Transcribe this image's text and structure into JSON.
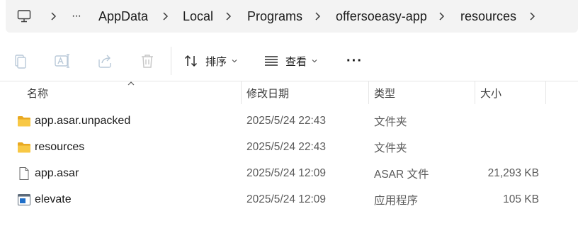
{
  "breadcrumb": {
    "items": [
      "AppData",
      "Local",
      "Programs",
      "offersoeasy-app",
      "resources"
    ],
    "more_label": "···"
  },
  "toolbar": {
    "sort_label": "排序",
    "view_label": "查看",
    "more_label": "···"
  },
  "columns": {
    "name": "名称",
    "modified": "修改日期",
    "type": "类型",
    "size": "大小"
  },
  "files": [
    {
      "name": "app.asar.unpacked",
      "modified": "2025/5/24 22:43",
      "type": "文件夹",
      "size": "",
      "icon": "folder-icon"
    },
    {
      "name": "resources",
      "modified": "2025/5/24 22:43",
      "type": "文件夹",
      "size": "",
      "icon": "folder-icon"
    },
    {
      "name": "app.asar",
      "modified": "2025/5/24 12:09",
      "type": "ASAR 文件",
      "size": "21,293 KB",
      "icon": "file-icon"
    },
    {
      "name": "elevate",
      "modified": "2025/5/24 12:09",
      "type": "应用程序",
      "size": "105 KB",
      "icon": "exe-icon"
    }
  ],
  "colors": {
    "folder": "#f8c845",
    "accent": "#0067c0"
  }
}
